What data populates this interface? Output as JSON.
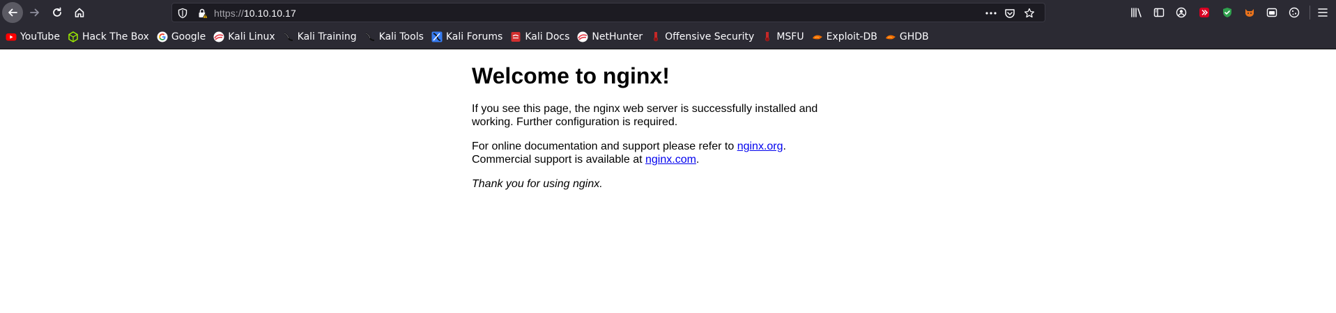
{
  "browser": {
    "url_scheme": "https://",
    "url_host": "10.10.10.17"
  },
  "bookmarks": [
    {
      "label": "YouTube",
      "icon": "youtube-icon",
      "color": "#ff0000"
    },
    {
      "label": "Hack The Box",
      "icon": "hackthebox-icon",
      "color": "#9fef00"
    },
    {
      "label": "Google",
      "icon": "google-icon",
      "color": "#4285f4"
    },
    {
      "label": "Kali Linux",
      "icon": "kali-linux-icon",
      "color": "#e63946"
    },
    {
      "label": "Kali Training",
      "icon": "kali-training-icon",
      "color": "#1b1b1b"
    },
    {
      "label": "Kali Tools",
      "icon": "kali-tools-icon",
      "color": "#1b1b1b"
    },
    {
      "label": "Kali Forums",
      "icon": "kali-forums-icon",
      "color": "#367bf0"
    },
    {
      "label": "Kali Docs",
      "icon": "kali-docs-icon",
      "color": "#d32f2f"
    },
    {
      "label": "NetHunter",
      "icon": "nethunter-icon",
      "color": "#e63946"
    },
    {
      "label": "Offensive Security",
      "icon": "offensive-security-icon",
      "color": "#c62828"
    },
    {
      "label": "MSFU",
      "icon": "msfu-icon",
      "color": "#c62828"
    },
    {
      "label": "Exploit-DB",
      "icon": "exploit-db-icon",
      "color": "#ef6c00"
    },
    {
      "label": "GHDB",
      "icon": "ghdb-icon",
      "color": "#ef6c00"
    }
  ],
  "page": {
    "heading": "Welcome to nginx!",
    "para1": "If you see this page, the nginx web server is successfully installed and working. Further configuration is required.",
    "para2_prefix": "For online documentation and support please refer to ",
    "link_org": "nginx.org",
    "para2_mid": ".",
    "para2_line2": "Commercial support is available at ",
    "link_com": "nginx.com",
    "para2_end": ".",
    "thanks": "Thank you for using nginx."
  },
  "colors": {
    "toolbar_bg": "#2b2a33",
    "urlbar_bg": "#1c1b22",
    "link": "#0000ee"
  }
}
